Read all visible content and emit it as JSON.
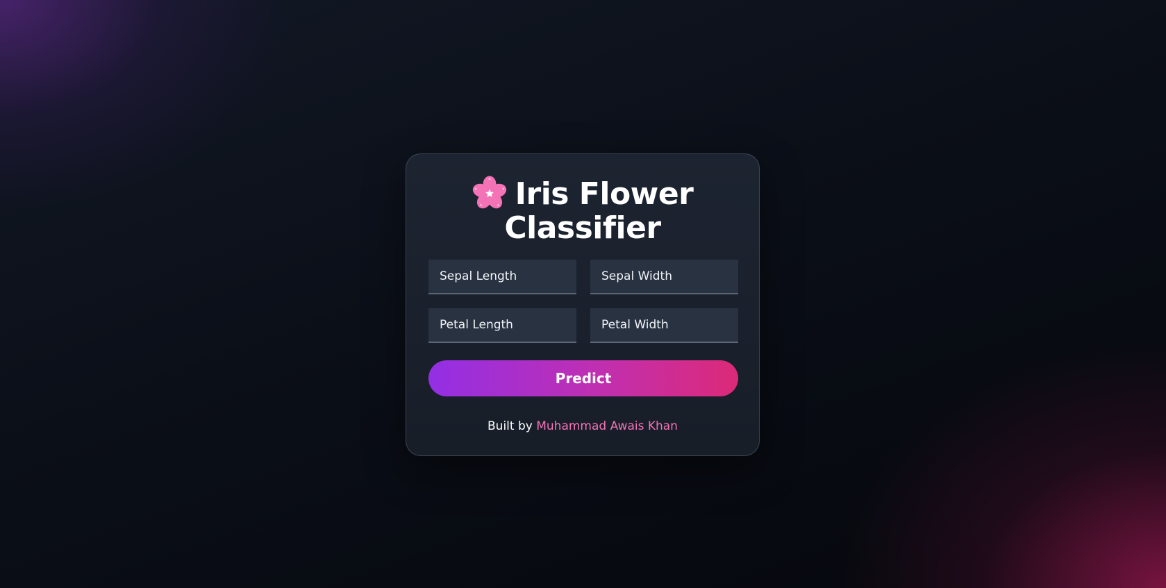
{
  "header": {
    "title_line1": "Iris Flower",
    "title_line2": "Classifier",
    "icon": "cherry-blossom-icon",
    "icon_color": "#f472b6"
  },
  "form": {
    "fields": [
      {
        "placeholder": "Sepal Length",
        "value": ""
      },
      {
        "placeholder": "Sepal Width",
        "value": ""
      },
      {
        "placeholder": "Petal Length",
        "value": ""
      },
      {
        "placeholder": "Petal Width",
        "value": ""
      }
    ],
    "submit_label": "Predict",
    "submit_gradient": [
      "#932fe5",
      "#dc2a78"
    ]
  },
  "footer": {
    "prefix": "Built by",
    "author": "Muhammad Awais Khan",
    "author_color": "#f472b6"
  },
  "theme": {
    "background": "#0b0f17",
    "card_background": "#1b212c",
    "input_background": "#283241"
  }
}
